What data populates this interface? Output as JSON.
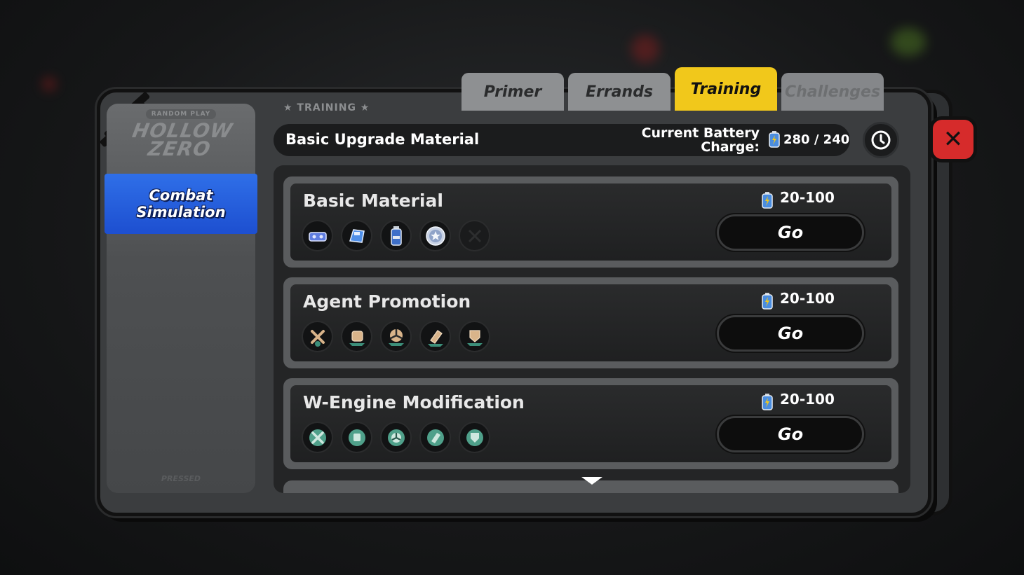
{
  "tabs": [
    {
      "label": "Primer",
      "state": "inactive"
    },
    {
      "label": "Errands",
      "state": "inactive"
    },
    {
      "label": "Training",
      "state": "active"
    },
    {
      "label": "Challenges",
      "state": "dim"
    }
  ],
  "left_panel": {
    "logo_tag": "RANDOM PLAY",
    "logo_text": "HOLLOW ZERO",
    "selected_item": "Combat Simulation",
    "footer": "PRESSED"
  },
  "section_title": "★ TRAINING ★",
  "header": {
    "title": "Basic Upgrade Material",
    "battery_label": "Current Battery Charge:",
    "battery_value": "280 / 240"
  },
  "cards": [
    {
      "title": "Basic Material",
      "cost": "20-100",
      "go_label": "Go",
      "materials": [
        "chip-icon",
        "disk-icon",
        "battery-icon",
        "star-gear-icon",
        "locked-slot-icon"
      ]
    },
    {
      "title": "Agent Promotion",
      "cost": "20-100",
      "go_label": "Go",
      "materials": [
        "crossed-tools-icon",
        "fist-icon",
        "fan-icon",
        "bullet-icon",
        "shield-icon"
      ]
    },
    {
      "title": "W-Engine Modification",
      "cost": "20-100",
      "go_label": "Go",
      "materials": [
        "crossed-tools-icon",
        "fist-icon",
        "fan-icon",
        "bullet-icon",
        "shield-icon"
      ]
    }
  ],
  "colors": {
    "accent_yellow": "#f1c81b",
    "combat_blue": "#2f6fe8",
    "close_red": "#d62b2b"
  }
}
